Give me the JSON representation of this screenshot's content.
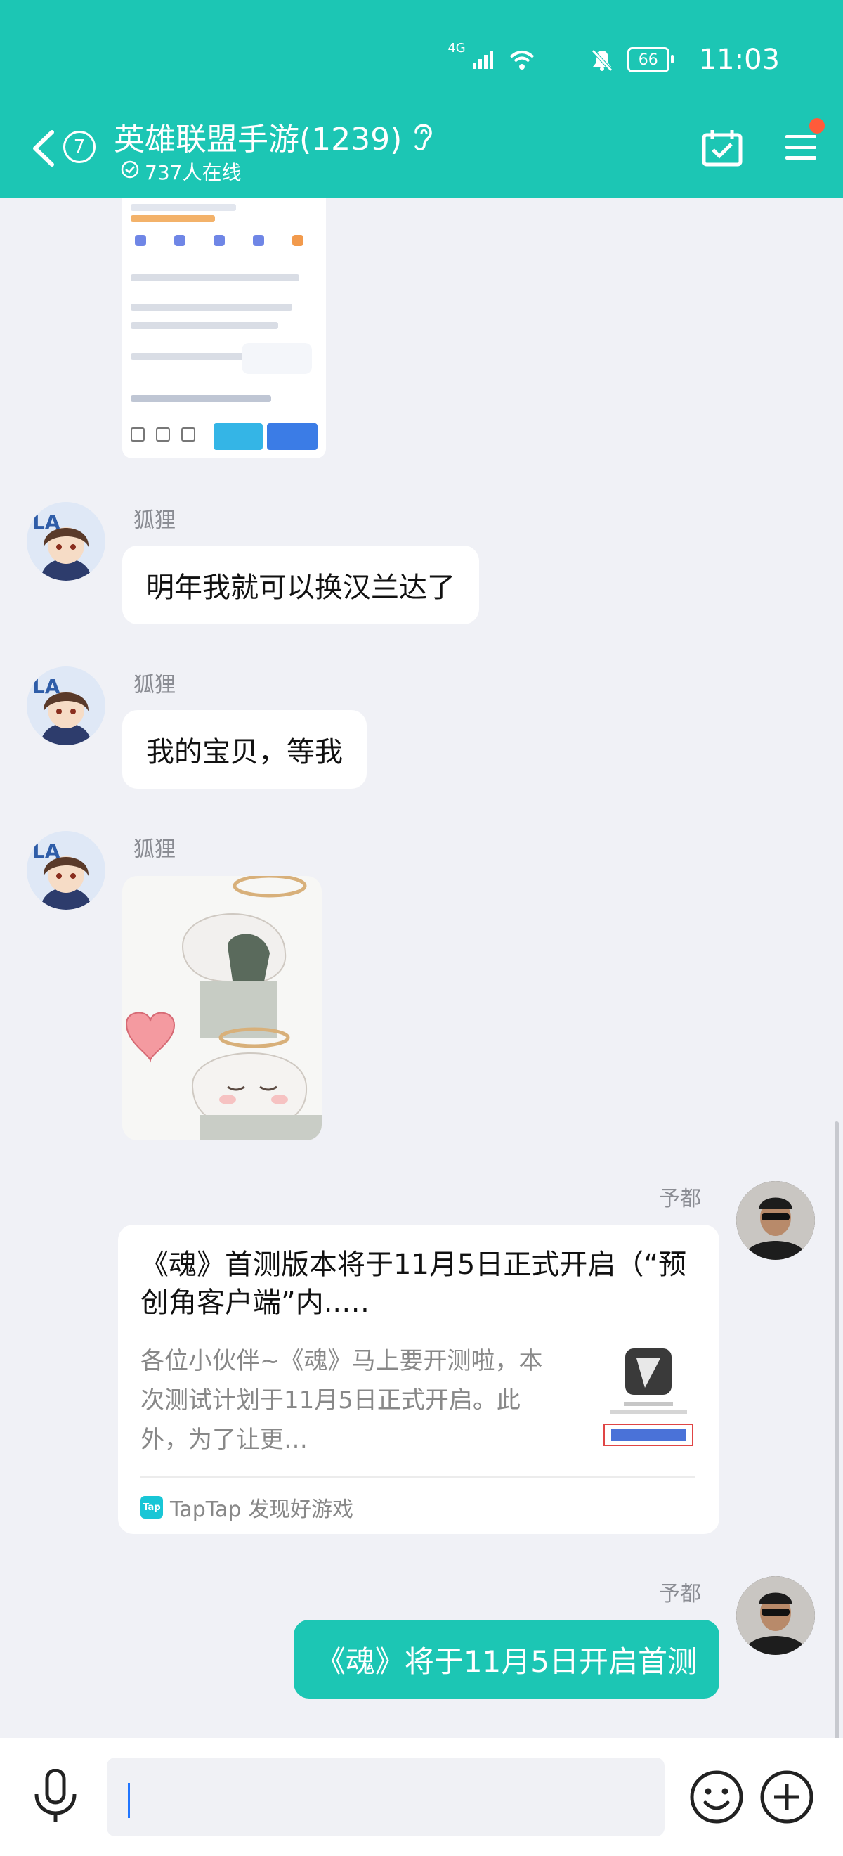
{
  "status_bar": {
    "network": "4G",
    "battery": "66",
    "time": "11:03"
  },
  "header": {
    "unread_count": "7",
    "title": "英雄联盟手游(1239)",
    "online": "737人在线"
  },
  "messages": [
    {
      "sender": "狐狸",
      "text": "明年我就可以换汉兰达了"
    },
    {
      "sender": "狐狸",
      "text": "我的宝贝，等我"
    },
    {
      "sender": "狐狸",
      "type": "sticker"
    }
  ],
  "shared_card": {
    "sender": "予都",
    "title": "《魂》首测版本将于11月5日正式开启（“预创角客户端”内..…",
    "description": "各位小伙伴~《魂》马上要开测啦，本次测试计划于11月5日正式开启。此外，为了让更…",
    "source": "TapTap 发现好游戏",
    "source_logo": "Tap"
  },
  "last_message": {
    "sender": "予都",
    "text": "《魂》将于11月5日开启首测"
  },
  "colors": {
    "accent": "#1cc6b4",
    "chat_bg": "#f0f1f6",
    "badge_dot": "#ff5b3a"
  }
}
